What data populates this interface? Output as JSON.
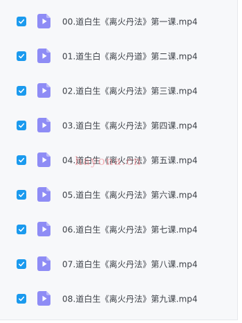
{
  "colors": {
    "checkbox": "#1b9aee",
    "video_icon": "#8e8cf5",
    "watermark": "#f0788a"
  },
  "files": [
    {
      "name": "00.道白生《离火丹法》第一课.mp4",
      "checked": true,
      "icon": "video-file-icon"
    },
    {
      "name": "01.道生白《离火丹道》第二课.mp4",
      "checked": true,
      "icon": "video-file-icon"
    },
    {
      "name": "02.道白生《离火丹法》第三课.mp4",
      "checked": true,
      "icon": "video-file-icon"
    },
    {
      "name": "03.道白生《离火丹法》第四课.mp4",
      "checked": true,
      "icon": "video-file-icon"
    },
    {
      "name": "04.道白生《离火丹法》第五课.mp4",
      "checked": true,
      "icon": "video-file-icon"
    },
    {
      "name": "05.道白生《离火丹法》第六课.mp4",
      "checked": true,
      "icon": "video-file-icon"
    },
    {
      "name": "06.道白生《离火丹法》第七课.mp4",
      "checked": true,
      "icon": "video-file-icon"
    },
    {
      "name": "07.道白生《离火丹法》第八课.mp4",
      "checked": true,
      "icon": "video-file-icon"
    },
    {
      "name": "08.道白生《离火丹法》第九课.mp4",
      "checked": true,
      "icon": "video-file-icon"
    }
  ],
  "watermark": "hayona.cn"
}
